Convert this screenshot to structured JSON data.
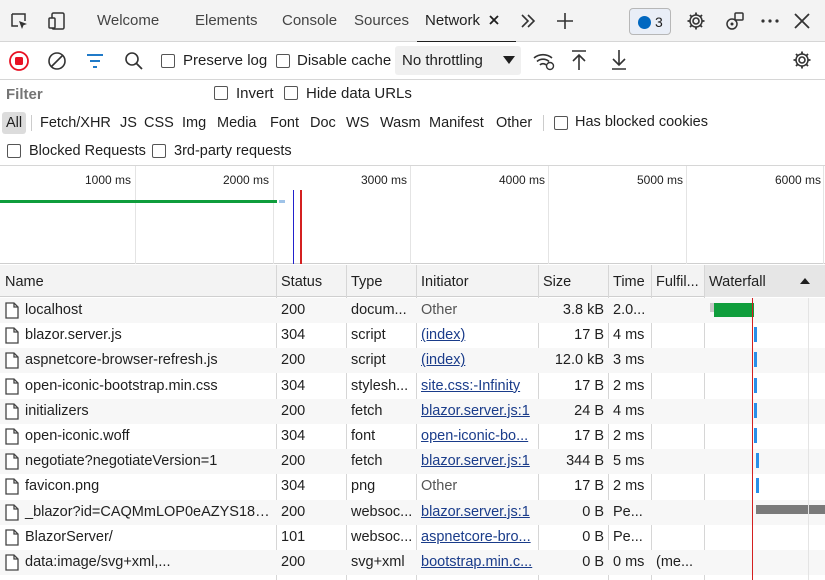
{
  "tabs": [
    "Welcome",
    "Elements",
    "Console",
    "Sources",
    "Network"
  ],
  "issues_count": "3",
  "toolbar": {
    "preserve_log": "Preserve log",
    "disable_cache": "Disable cache",
    "throttling": "No throttling"
  },
  "filter": {
    "placeholder": "Filter",
    "invert": "Invert",
    "hide_data_urls": "Hide data URLs"
  },
  "types": [
    "All",
    "Fetch/XHR",
    "JS",
    "CSS",
    "Img",
    "Media",
    "Font",
    "Doc",
    "WS",
    "Wasm",
    "Manifest",
    "Other"
  ],
  "has_blocked_cookies": "Has blocked cookies",
  "blocked_requests": "Blocked Requests",
  "third_party": "3rd-party requests",
  "overview": {
    "ticks": [
      "1000 ms",
      "2000 ms",
      "3000 ms",
      "4000 ms",
      "5000 ms",
      "6000 ms"
    ]
  },
  "columns": [
    "Name",
    "Status",
    "Type",
    "Initiator",
    "Size",
    "Time",
    "Fulfil...",
    "Waterfall"
  ],
  "rows": [
    {
      "name": "localhost",
      "status": "200",
      "type": "docum...",
      "initiator": "Other",
      "size": "3.8 kB",
      "time": "2.0...",
      "fulfilled": ""
    },
    {
      "name": "blazor.server.js",
      "status": "304",
      "type": "script",
      "initiator": "(index)",
      "size": "17 B",
      "time": "4 ms",
      "fulfilled": ""
    },
    {
      "name": "aspnetcore-browser-refresh.js",
      "status": "200",
      "type": "script",
      "initiator": "(index)",
      "size": "12.0 kB",
      "time": "3 ms",
      "fulfilled": ""
    },
    {
      "name": "open-iconic-bootstrap.min.css",
      "status": "304",
      "type": "stylesh...",
      "initiator": "site.css:-Infinity",
      "size": "17 B",
      "time": "2 ms",
      "fulfilled": ""
    },
    {
      "name": "initializers",
      "status": "200",
      "type": "fetch",
      "initiator": "blazor.server.js:1",
      "size": "24 B",
      "time": "4 ms",
      "fulfilled": ""
    },
    {
      "name": "open-iconic.woff",
      "status": "304",
      "type": "font",
      "initiator": "open-iconic-bo...",
      "size": "17 B",
      "time": "2 ms",
      "fulfilled": ""
    },
    {
      "name": "negotiate?negotiateVersion=1",
      "status": "200",
      "type": "fetch",
      "initiator": "blazor.server.js:1",
      "size": "344 B",
      "time": "5 ms",
      "fulfilled": ""
    },
    {
      "name": "favicon.png",
      "status": "304",
      "type": "png",
      "initiator": "Other",
      "size": "17 B",
      "time": "2 ms",
      "fulfilled": ""
    },
    {
      "name": "_blazor?id=CAQMmLOP0eAZYS182z...",
      "status": "200",
      "type": "websoc...",
      "initiator": "blazor.server.js:1",
      "size": "0 B",
      "time": "Pe...",
      "fulfilled": ""
    },
    {
      "name": "BlazorServer/",
      "status": "101",
      "type": "websoc...",
      "initiator": "aspnetcore-bro...",
      "size": "0 B",
      "time": "Pe...",
      "fulfilled": ""
    },
    {
      "name": "data:image/svg+xml,...",
      "status": "200",
      "type": "svg+xml",
      "initiator": "bootstrap.min.c...",
      "size": "0 B",
      "time": "0 ms",
      "fulfilled": "(me..."
    }
  ],
  "colors": {
    "accent": "#0067c0",
    "record": "#e81123",
    "link": "#1a3c8a",
    "waterfall_green": "#0f9d3c",
    "waterfall_blue": "#2a8ee8"
  }
}
